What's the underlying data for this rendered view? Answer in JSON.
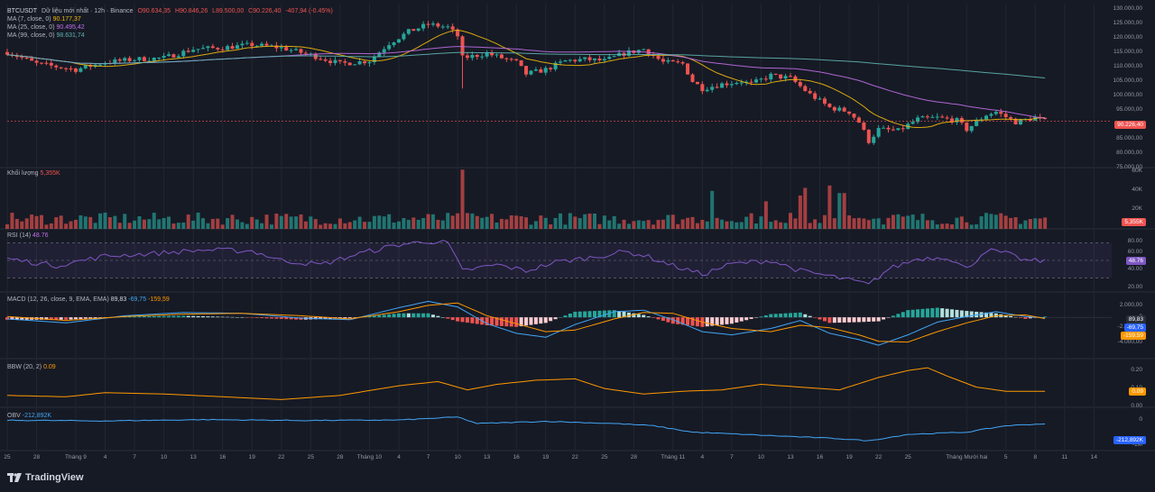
{
  "header": {
    "symbol": "BTCUSDT",
    "desc": "Dữ liệu mới nhất · 12h · Binance",
    "open": "O90.634,35",
    "high": "H90.846,26",
    "low": "L89.500,00",
    "close": "C90.226,40",
    "change": "-407,94 (-0.45%)"
  },
  "legend": {
    "ma7_label": "MA (7, close, 0)",
    "ma7_value": "90.177,37",
    "ma25_label": "MA (25, close, 0)",
    "ma25_value": "90.495,42",
    "ma99_label": "MA (99, close, 0)",
    "ma99_value": "98.631,74"
  },
  "price_axis": [
    "130.000,00",
    "125.000,00",
    "120.000,00",
    "115.000,00",
    "110.000,00",
    "105.000,00",
    "100.000,00",
    "95.000,00",
    "85.000,00",
    "80.000,00",
    "75.000,00"
  ],
  "price_tag": "90.226,40",
  "volume": {
    "label": "Khối lượng",
    "value": "5,355K",
    "axis": [
      "60K",
      "40K",
      "20K",
      "0"
    ],
    "tag": "5,355K"
  },
  "rsi": {
    "label": "RSI (14)",
    "value": "48.76",
    "axis": [
      "80.00",
      "60.00",
      "40.00",
      "20.00"
    ],
    "tag": "48.76"
  },
  "macd": {
    "label": "MACD (12, 26, close, 9, EMA, EMA)",
    "hist": "89,83",
    "macd": "-69,75",
    "signal": "-159,59",
    "axis": [
      "2.000,00",
      "0",
      "-2.000,00",
      "-4.000,00"
    ],
    "tags": [
      "89,83",
      "-69,75",
      "-159,59"
    ]
  },
  "bbw": {
    "label": "BBW (20, 2)",
    "value": "0.09",
    "axis": [
      "0.20",
      "0.10",
      "0.00"
    ],
    "tag": "0.09"
  },
  "obv": {
    "label": "OBV",
    "value": "-212,892K",
    "axis": [
      "0",
      "-1M"
    ],
    "tag": "-212,892K"
  },
  "x_axis": [
    {
      "label": "25",
      "day": 0
    },
    {
      "label": "28",
      "day": 3
    },
    {
      "label": "Tháng 9",
      "day": 7
    },
    {
      "label": "4",
      "day": 10
    },
    {
      "label": "7",
      "day": 13
    },
    {
      "label": "10",
      "day": 16
    },
    {
      "label": "13",
      "day": 19
    },
    {
      "label": "16",
      "day": 22
    },
    {
      "label": "19",
      "day": 25
    },
    {
      "label": "22",
      "day": 28
    },
    {
      "label": "25",
      "day": 31
    },
    {
      "label": "28",
      "day": 34
    },
    {
      "label": "Tháng 10",
      "day": 37
    },
    {
      "label": "4",
      "day": 40
    },
    {
      "label": "7",
      "day": 43
    },
    {
      "label": "10",
      "day": 46
    },
    {
      "label": "13",
      "day": 49
    },
    {
      "label": "16",
      "day": 52
    },
    {
      "label": "19",
      "day": 55
    },
    {
      "label": "22",
      "day": 58
    },
    {
      "label": "25",
      "day": 61
    },
    {
      "label": "28",
      "day": 64
    },
    {
      "label": "Tháng 11",
      "day": 68
    },
    {
      "label": "4",
      "day": 71
    },
    {
      "label": "7",
      "day": 74
    },
    {
      "label": "10",
      "day": 77
    },
    {
      "label": "13",
      "day": 80
    },
    {
      "label": "16",
      "day": 83
    },
    {
      "label": "19",
      "day": 86
    },
    {
      "label": "22",
      "day": 89
    },
    {
      "label": "25",
      "day": 92
    },
    {
      "label": "Tháng Mười hai",
      "day": 98
    },
    {
      "label": "5",
      "day": 102
    },
    {
      "label": "8",
      "day": 105
    },
    {
      "label": "11",
      "day": 108
    },
    {
      "label": "14",
      "day": 111
    }
  ],
  "colors": {
    "up": "#26a69a",
    "down": "#ef5350",
    "ma7": "#f0b90b",
    "ma25": "#c06ee6",
    "ma99": "#5fb3b0",
    "rsi": "#7e57c2",
    "macd": "#42a5f5",
    "signal": "#ff9800",
    "bbw": "#ff9800",
    "obv": "#42a5f5",
    "background": "#161a25",
    "grid": "#22262f"
  },
  "brand": "TradingView",
  "chart_data": {
    "type": "candlestick",
    "title": "BTCUSDT · 12h · Binance",
    "timeframe": "12h",
    "x_unit": "days since Aug 25",
    "price_anchors": [
      [
        0,
        114000
      ],
      [
        3,
        110000
      ],
      [
        7,
        108000
      ],
      [
        10,
        110500
      ],
      [
        13,
        111500
      ],
      [
        16,
        112000
      ],
      [
        19,
        115000
      ],
      [
        22,
        115500
      ],
      [
        25,
        116500
      ],
      [
        28,
        115500
      ],
      [
        31,
        113000
      ],
      [
        34,
        110000
      ],
      [
        37,
        111000
      ],
      [
        39,
        117000
      ],
      [
        41,
        121000
      ],
      [
        43,
        123500
      ],
      [
        45,
        122500
      ],
      [
        46,
        119500
      ],
      [
        46.5,
        112000
      ],
      [
        49,
        113500
      ],
      [
        52,
        110500
      ],
      [
        53,
        106500
      ],
      [
        55,
        108000
      ],
      [
        57,
        111000
      ],
      [
        59,
        111500
      ],
      [
        61,
        111000
      ],
      [
        63,
        113500
      ],
      [
        65,
        115000
      ],
      [
        67,
        110500
      ],
      [
        69,
        110000
      ],
      [
        70,
        104000
      ],
      [
        71,
        101500
      ],
      [
        73,
        103000
      ],
      [
        75,
        104000
      ],
      [
        76,
        103000
      ],
      [
        78,
        106000
      ],
      [
        80,
        105000
      ],
      [
        82,
        99500
      ],
      [
        84,
        95000
      ],
      [
        86,
        93500
      ],
      [
        87,
        90000
      ],
      [
        88,
        83500
      ],
      [
        89,
        87500
      ],
      [
        91,
        87000
      ],
      [
        93,
        91000
      ],
      [
        95,
        91500
      ],
      [
        97,
        90500
      ],
      [
        98,
        87500
      ],
      [
        100,
        92500
      ],
      [
        101,
        93500
      ],
      [
        103,
        90000
      ],
      [
        105,
        91500
      ],
      [
        106,
        90226
      ]
    ],
    "volume_scale": [
      0,
      60000
    ],
    "rsi_anchors": [
      [
        0,
        52
      ],
      [
        5,
        44
      ],
      [
        10,
        55
      ],
      [
        15,
        58
      ],
      [
        20,
        62
      ],
      [
        25,
        61
      ],
      [
        28,
        50
      ],
      [
        32,
        45
      ],
      [
        36,
        58
      ],
      [
        40,
        68
      ],
      [
        43,
        72
      ],
      [
        45,
        70
      ],
      [
        46.5,
        38
      ],
      [
        50,
        45
      ],
      [
        53,
        38
      ],
      [
        56,
        48
      ],
      [
        60,
        54
      ],
      [
        63,
        60
      ],
      [
        65,
        56
      ],
      [
        68,
        44
      ],
      [
        71,
        34
      ],
      [
        74,
        46
      ],
      [
        78,
        50
      ],
      [
        81,
        38
      ],
      [
        84,
        32
      ],
      [
        87,
        25
      ],
      [
        88,
        22
      ],
      [
        90,
        40
      ],
      [
        93,
        52
      ],
      [
        96,
        54
      ],
      [
        98,
        40
      ],
      [
        100,
        62
      ],
      [
        102,
        58
      ],
      [
        104,
        50
      ],
      [
        106,
        49
      ]
    ],
    "macd_anchors": [
      [
        0,
        -200,
        100
      ],
      [
        6,
        -700,
        -400
      ],
      [
        12,
        200,
        100
      ],
      [
        18,
        600,
        400
      ],
      [
        24,
        500,
        500
      ],
      [
        30,
        -100,
        200
      ],
      [
        35,
        -300,
        -200
      ],
      [
        40,
        1200,
        700
      ],
      [
        43,
        2000,
        1500
      ],
      [
        46,
        1300,
        1800
      ],
      [
        49,
        -800,
        200
      ],
      [
        52,
        -2000,
        -800
      ],
      [
        55,
        -2500,
        -1800
      ],
      [
        58,
        -900,
        -1600
      ],
      [
        62,
        700,
        -200
      ],
      [
        65,
        900,
        600
      ],
      [
        68,
        -300,
        500
      ],
      [
        71,
        -1800,
        -600
      ],
      [
        74,
        -2200,
        -1400
      ],
      [
        78,
        -1400,
        -1800
      ],
      [
        81,
        -400,
        -1000
      ],
      [
        84,
        -2000,
        -1300
      ],
      [
        87,
        -2800,
        -2200
      ],
      [
        89,
        -3500,
        -3000
      ],
      [
        92,
        -2200,
        -3100
      ],
      [
        95,
        -600,
        -1800
      ],
      [
        98,
        100,
        -700
      ],
      [
        101,
        700,
        200
      ],
      [
        104,
        100,
        300
      ],
      [
        106,
        -70,
        -160
      ]
    ],
    "bbw_anchors": [
      [
        0,
        0.06
      ],
      [
        6,
        0.05
      ],
      [
        10,
        0.08
      ],
      [
        16,
        0.07
      ],
      [
        22,
        0.05
      ],
      [
        28,
        0.03
      ],
      [
        34,
        0.06
      ],
      [
        40,
        0.13
      ],
      [
        44,
        0.16
      ],
      [
        47,
        0.1
      ],
      [
        50,
        0.14
      ],
      [
        54,
        0.17
      ],
      [
        58,
        0.18
      ],
      [
        61,
        0.11
      ],
      [
        65,
        0.07
      ],
      [
        69,
        0.09
      ],
      [
        73,
        0.1
      ],
      [
        77,
        0.14
      ],
      [
        81,
        0.12
      ],
      [
        85,
        0.1
      ],
      [
        89,
        0.19
      ],
      [
        92,
        0.24
      ],
      [
        94,
        0.26
      ],
      [
        96,
        0.2
      ],
      [
        99,
        0.12
      ],
      [
        102,
        0.09
      ],
      [
        106,
        0.09
      ]
    ],
    "obv_anchors": [
      [
        0,
        -50
      ],
      [
        10,
        -80
      ],
      [
        20,
        -20
      ],
      [
        30,
        -60
      ],
      [
        40,
        -40
      ],
      [
        46,
        100
      ],
      [
        48,
        -200
      ],
      [
        55,
        -100
      ],
      [
        62,
        -200
      ],
      [
        66,
        -300
      ],
      [
        70,
        -600
      ],
      [
        75,
        -700
      ],
      [
        80,
        -800
      ],
      [
        85,
        -900
      ],
      [
        88,
        -1000
      ],
      [
        92,
        -700
      ],
      [
        98,
        -600
      ],
      [
        102,
        -300
      ],
      [
        106,
        -213
      ]
    ],
    "price_range": [
      75000,
      130000
    ],
    "rsi_range": [
      20,
      80
    ],
    "macd_range": [
      -4500,
      2500
    ],
    "bbw_range": [
      0,
      0.3
    ],
    "obv_range": [
      -1200,
      300
    ]
  }
}
